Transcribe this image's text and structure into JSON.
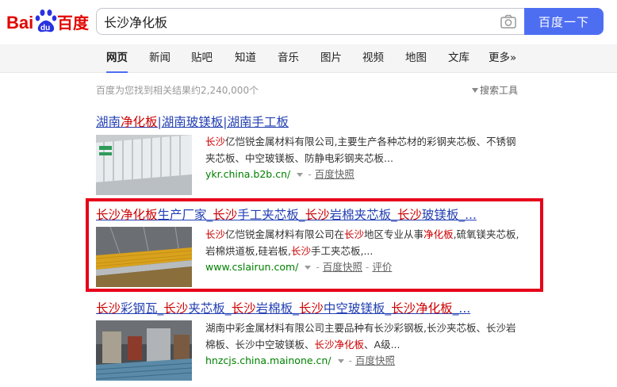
{
  "header": {
    "logo_text_left": "Bai",
    "logo_text_du": "du",
    "logo_text_right": "百度",
    "search_value": "长沙净化板",
    "search_button": "百度一下",
    "camera_icon": "camera-icon"
  },
  "tabs": [
    {
      "label": "网页",
      "active": true
    },
    {
      "label": "新闻"
    },
    {
      "label": "贴吧"
    },
    {
      "label": "知道"
    },
    {
      "label": "音乐"
    },
    {
      "label": "图片"
    },
    {
      "label": "视频"
    },
    {
      "label": "地图"
    },
    {
      "label": "文库"
    },
    {
      "label": "更多»"
    }
  ],
  "stats": "百度为您找到相关结果约2,240,000个",
  "tools_label": "搜索工具",
  "results": [
    {
      "title_parts": [
        [
          "湖南",
          ""
        ],
        [
          "净化板",
          "em"
        ],
        [
          "|湖南玻镁板|湖南手工板",
          ""
        ]
      ],
      "snippet_parts": [
        [
          "长沙",
          "em"
        ],
        [
          "亿恺锐金属材料有限公司,主要生产各种芯材的彩钢夹芯板、不锈钢夹芯板、中空玻镁板、防静电彩钢夹芯板...",
          ""
        ]
      ],
      "url": "ykr.china.b2b.cn/",
      "links": [
        "百度快照"
      ]
    },
    {
      "title_parts": [
        [
          "长沙净化板",
          "em"
        ],
        [
          "生产厂家_",
          ""
        ],
        [
          "长沙",
          "em"
        ],
        [
          "手工夹芯板_",
          ""
        ],
        [
          "长沙",
          "em"
        ],
        [
          "岩棉夹芯板_",
          ""
        ],
        [
          "长沙",
          "em"
        ],
        [
          "玻镁板_...",
          ""
        ]
      ],
      "snippet_parts": [
        [
          "长沙",
          "em"
        ],
        [
          "亿恺锐金属材料有限公司在",
          ""
        ],
        [
          "长沙",
          "em"
        ],
        [
          "地区专业从事",
          ""
        ],
        [
          "净化板",
          "em"
        ],
        [
          ",硫氧镁夹芯板,岩棉烘道板,硅岩板,",
          ""
        ],
        [
          "长沙",
          "em"
        ],
        [
          "手工夹芯板,...",
          ""
        ]
      ],
      "url": "www.cslairun.com/",
      "links": [
        "百度快照",
        "评价"
      ]
    },
    {
      "title_parts": [
        [
          "长沙",
          "em"
        ],
        [
          "彩钢瓦_",
          ""
        ],
        [
          "长沙",
          "em"
        ],
        [
          "夹芯板_",
          ""
        ],
        [
          "长沙",
          "em"
        ],
        [
          "岩棉板_",
          ""
        ],
        [
          "长沙",
          "em"
        ],
        [
          "中空玻镁板_",
          ""
        ],
        [
          "长沙净化板",
          "em"
        ],
        [
          "_...",
          ""
        ]
      ],
      "snippet_parts": [
        [
          "湖南中彩金属材料有限公司主要品种有长沙彩钢板,长沙夹芯板、长沙岩棉板、长沙中空玻镁板、",
          ""
        ],
        [
          "长沙净化板",
          "em"
        ],
        [
          "、A级...",
          ""
        ]
      ],
      "url": "hnzcjs.china.mainone.cn/",
      "links": [
        "百度快照"
      ]
    }
  ],
  "colors": {
    "brand_blue": "#4e6ef2",
    "logo_red": "#e10601",
    "logo_blue": "#2932e1",
    "link_blue": "#2440b3",
    "highlight_red": "#c00",
    "url_green": "#008000",
    "annotation_box": "#e6001a"
  }
}
